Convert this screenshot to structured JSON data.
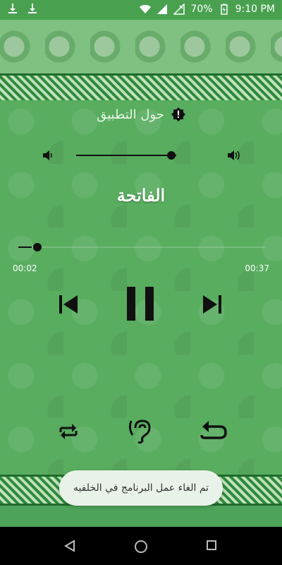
{
  "status_bar": {
    "battery_text": "70%",
    "time": "9:10 PM",
    "icons": [
      "download-icon",
      "download-icon",
      "wifi-icon",
      "signal-icon",
      "no-signal-icon",
      "battery-icon"
    ]
  },
  "header": {
    "about_label": "حول التطبيق",
    "about_icon": "alert-badge-icon"
  },
  "volume": {
    "level": 0.95,
    "low_icon": "volume-low-icon",
    "high_icon": "volume-high-icon"
  },
  "player": {
    "surah_title": "الفاتحة",
    "elapsed": "00:02",
    "duration": "00:37",
    "progress": 0.054,
    "controls": [
      "previous-icon",
      "pause-icon",
      "next-icon"
    ]
  },
  "bottom_controls": [
    "repeat-icon",
    "hearing-icon",
    "replay-icon"
  ],
  "toast": {
    "message": "تم الغاء عمل البرنامج في الخلفيه"
  },
  "navbar": [
    "back-icon",
    "home-icon",
    "recents-icon"
  ],
  "colors": {
    "status_bar": "#49a150",
    "background": "#58ad5f",
    "border": "#1f6b2b",
    "toast_bg": "#e9f2e9",
    "controls": "#111111"
  }
}
